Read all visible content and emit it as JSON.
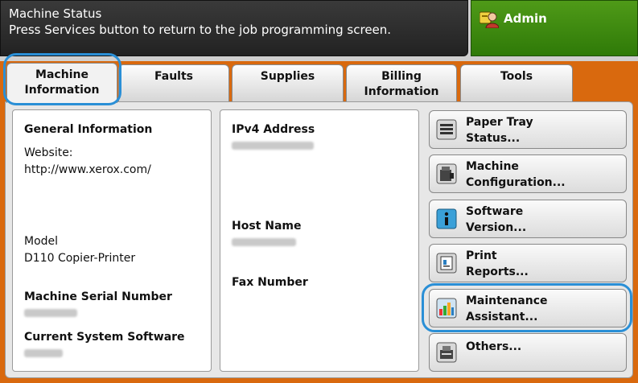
{
  "header": {
    "title": "Machine Status",
    "message": "Press Services button to return to the job programming screen."
  },
  "admin": {
    "label": "Admin"
  },
  "tabs": [
    {
      "line1": "Machine",
      "line2": "Information"
    },
    {
      "line1": "Faults",
      "line2": ""
    },
    {
      "line1": "Supplies",
      "line2": ""
    },
    {
      "line1": "Billing",
      "line2": "Information"
    },
    {
      "line1": "Tools",
      "line2": ""
    }
  ],
  "general": {
    "heading": "General Information",
    "website_label": "Website:",
    "website_value": "http://www.xerox.com/",
    "model_label": "Model",
    "model_value": "D110 Copier-Printer",
    "serial_label": "Machine Serial Number",
    "software_label": "Current System Software"
  },
  "network": {
    "ipv4_label": "IPv4 Address",
    "host_label": "Host Name",
    "fax_label": "Fax Number"
  },
  "buttons": [
    {
      "line1": "Paper Tray",
      "line2": "Status...",
      "icon": "paper-tray-icon"
    },
    {
      "line1": "Machine",
      "line2": "Configuration...",
      "icon": "machine-config-icon"
    },
    {
      "line1": "Software",
      "line2": "Version...",
      "icon": "info-icon"
    },
    {
      "line1": "Print",
      "line2": "Reports...",
      "icon": "print-reports-icon"
    },
    {
      "line1": "Maintenance",
      "line2": "Assistant...",
      "icon": "maintenance-chart-icon"
    },
    {
      "line1": "Others...",
      "line2": "",
      "icon": "others-icon"
    }
  ],
  "colors": {
    "accent_orange": "#d9690e",
    "admin_green": "#3f8a12",
    "highlight_blue": "#2a8fd6"
  }
}
